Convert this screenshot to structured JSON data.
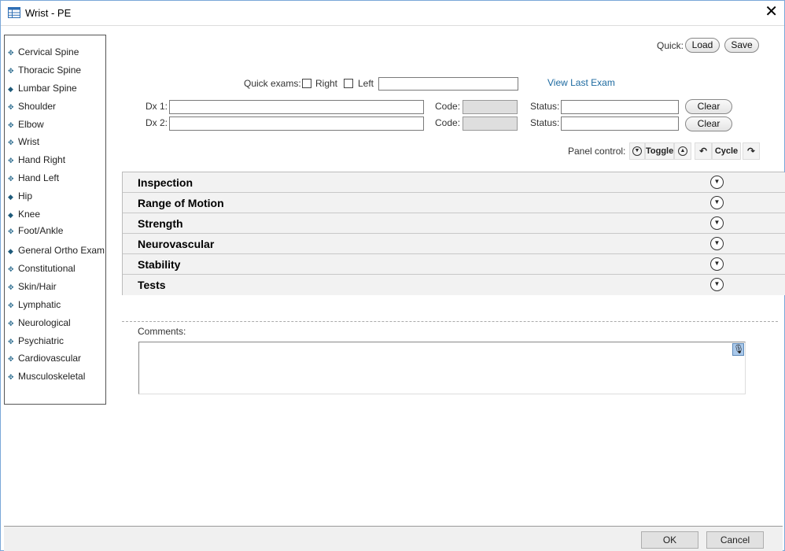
{
  "window": {
    "title": "Wrist - PE",
    "close_glyph": "✕"
  },
  "sidebar": {
    "items": [
      {
        "label": "Cervical Spine",
        "bullet": "✥"
      },
      {
        "label": "Thoracic Spine",
        "bullet": "✥"
      },
      {
        "label": "Lumbar Spine",
        "bullet": "◆"
      },
      {
        "label": "Shoulder",
        "bullet": "✥"
      },
      {
        "label": "Elbow",
        "bullet": "✥"
      },
      {
        "label": "Wrist",
        "bullet": "✥"
      },
      {
        "label": "Hand Right",
        "bullet": "✥"
      },
      {
        "label": "Hand Left",
        "bullet": "✥"
      },
      {
        "label": "Hip",
        "bullet": "◆"
      },
      {
        "label": "Knee",
        "bullet": "◆"
      },
      {
        "label": "Foot/Ankle",
        "bullet": "✥"
      },
      {
        "label": "General Ortho Exam",
        "bullet": "◆"
      },
      {
        "label": "Constitutional",
        "bullet": "✥"
      },
      {
        "label": "Skin/Hair",
        "bullet": "✥"
      },
      {
        "label": "Lymphatic",
        "bullet": "✥"
      },
      {
        "label": "Neurological",
        "bullet": "✥"
      },
      {
        "label": "Psychiatric",
        "bullet": "✥"
      },
      {
        "label": "Cardiovascular",
        "bullet": "✥"
      },
      {
        "label": "Musculoskeletal",
        "bullet": "✥"
      }
    ]
  },
  "quick": {
    "label": "Quick:",
    "load": "Load",
    "save": "Save"
  },
  "quick_exams": {
    "label": "Quick exams:",
    "right": "Right",
    "left": "Left",
    "value": "",
    "view_last": "View Last Exam"
  },
  "dx": [
    {
      "label": "Dx 1:",
      "value": "",
      "code_label": "Code:",
      "code": "",
      "status_label": "Status:",
      "status": "",
      "clear": "Clear"
    },
    {
      "label": "Dx 2:",
      "value": "",
      "code_label": "Code:",
      "code": "",
      "status_label": "Status:",
      "status": "",
      "clear": "Clear"
    }
  ],
  "panel_control": {
    "label": "Panel control:",
    "toggle": "Toggle",
    "cycle": "Cycle"
  },
  "sections": [
    {
      "title": "Inspection"
    },
    {
      "title": "Range of Motion"
    },
    {
      "title": "Strength"
    },
    {
      "title": "Neurovascular"
    },
    {
      "title": "Stability"
    },
    {
      "title": "Tests"
    }
  ],
  "comments": {
    "label": "Comments:",
    "value": ""
  },
  "footer": {
    "ok": "OK",
    "cancel": "Cancel"
  }
}
